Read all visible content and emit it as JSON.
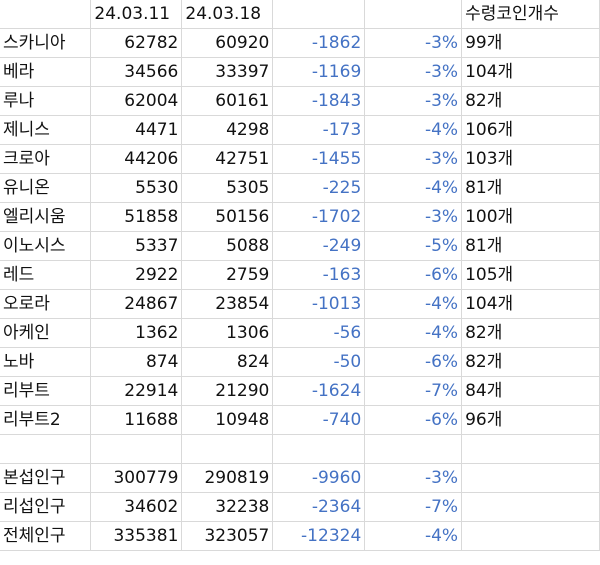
{
  "header": {
    "date1": "24.03.11",
    "date2": "24.03.18",
    "coins_label": "수령코인개수"
  },
  "rows": [
    {
      "name": "스카니아",
      "v1": "62782",
      "v2": "60920",
      "diff": "-1862",
      "pct": "-3%",
      "coins": "99개"
    },
    {
      "name": "베라",
      "v1": "34566",
      "v2": "33397",
      "diff": "-1169",
      "pct": "-3%",
      "coins": "104개"
    },
    {
      "name": "루나",
      "v1": "62004",
      "v2": "60161",
      "diff": "-1843",
      "pct": "-3%",
      "coins": "82개"
    },
    {
      "name": "제니스",
      "v1": "4471",
      "v2": "4298",
      "diff": "-173",
      "pct": "-4%",
      "coins": "106개"
    },
    {
      "name": "크로아",
      "v1": "44206",
      "v2": "42751",
      "diff": "-1455",
      "pct": "-3%",
      "coins": "103개"
    },
    {
      "name": "유니온",
      "v1": "5530",
      "v2": "5305",
      "diff": "-225",
      "pct": "-4%",
      "coins": "81개"
    },
    {
      "name": "엘리시움",
      "v1": "51858",
      "v2": "50156",
      "diff": "-1702",
      "pct": "-3%",
      "coins": "100개"
    },
    {
      "name": "이노시스",
      "v1": "5337",
      "v2": "5088",
      "diff": "-249",
      "pct": "-5%",
      "coins": "81개"
    },
    {
      "name": "레드",
      "v1": "2922",
      "v2": "2759",
      "diff": "-163",
      "pct": "-6%",
      "coins": "105개"
    },
    {
      "name": "오로라",
      "v1": "24867",
      "v2": "23854",
      "diff": "-1013",
      "pct": "-4%",
      "coins": "104개"
    },
    {
      "name": "아케인",
      "v1": "1362",
      "v2": "1306",
      "diff": "-56",
      "pct": "-4%",
      "coins": "82개"
    },
    {
      "name": "노바",
      "v1": "874",
      "v2": "824",
      "diff": "-50",
      "pct": "-6%",
      "coins": "82개"
    },
    {
      "name": "리부트",
      "v1": "22914",
      "v2": "21290",
      "diff": "-1624",
      "pct": "-7%",
      "coins": "84개"
    },
    {
      "name": "리부트2",
      "v1": "11688",
      "v2": "10948",
      "diff": "-740",
      "pct": "-6%",
      "coins": "96개"
    }
  ],
  "summary": [
    {
      "name": "본섭인구",
      "v1": "300779",
      "v2": "290819",
      "diff": "-9960",
      "pct": "-3%"
    },
    {
      "name": "리섭인구",
      "v1": "34602",
      "v2": "32238",
      "diff": "-2364",
      "pct": "-7%"
    },
    {
      "name": "전체인구",
      "v1": "335381",
      "v2": "323057",
      "diff": "-12324",
      "pct": "-4%"
    }
  ],
  "colors": {
    "negative_text": "#4472c4",
    "gridline": "#d9d9d9"
  }
}
